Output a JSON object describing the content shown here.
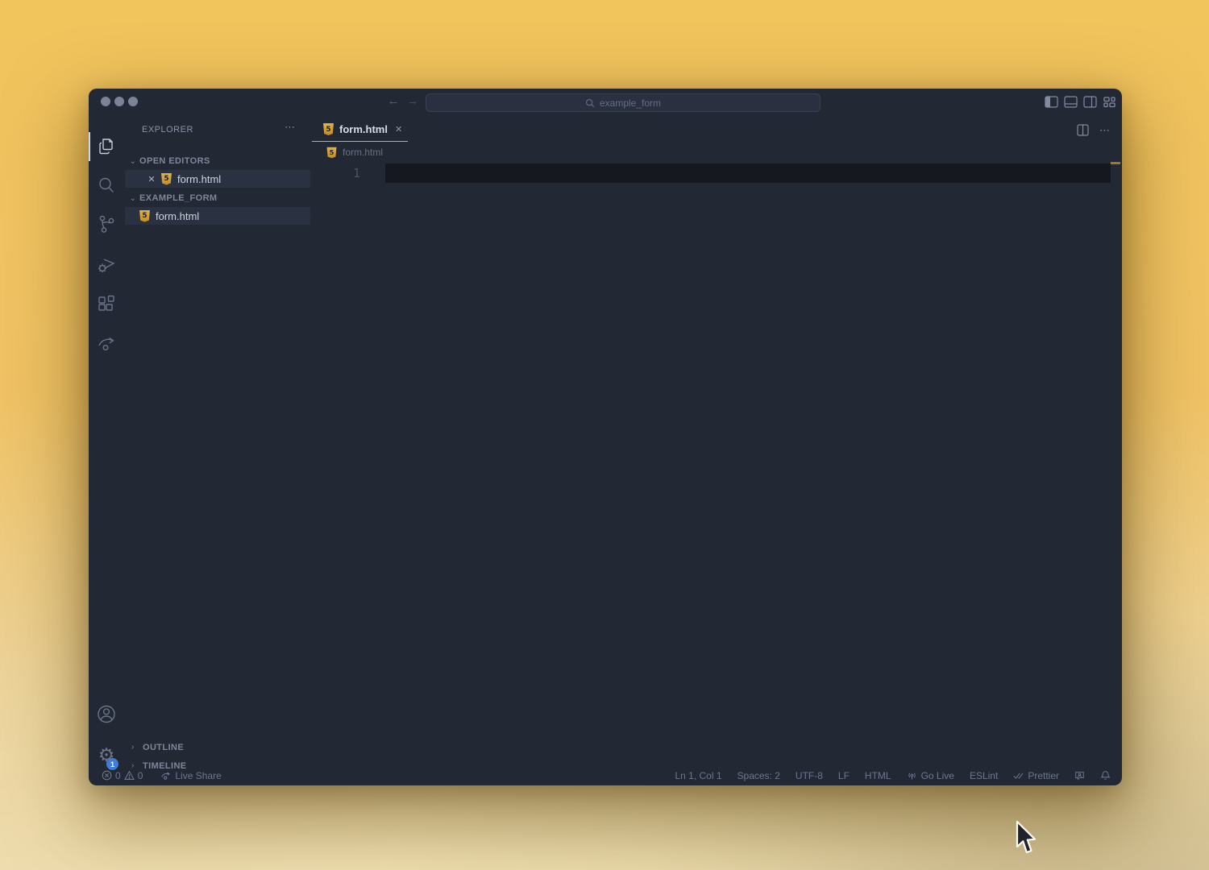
{
  "titlebar": {
    "search_value": "example_form",
    "back_icon": "←",
    "forward_icon": "→"
  },
  "icons": {
    "html_badge": "5",
    "close_icon": "✕",
    "ellipsis_icon": "⋯",
    "chevron_down": "⌄",
    "chevron_right": "›",
    "gear": "⚙"
  },
  "explorer": {
    "title": "EXPLORER",
    "open_editors_label": "OPEN EDITORS",
    "folder_label": "EXAMPLE_FORM",
    "open_editor_file": "form.html",
    "folder_file": "form.html",
    "outline_label": "OUTLINE",
    "timeline_label": "TIMELINE"
  },
  "editor": {
    "tab_label": "form.html",
    "breadcrumb_file": "form.html",
    "line_number": "1"
  },
  "badges": {
    "settings_count": "1"
  },
  "status_bar": {
    "errors": "0",
    "warnings": "0",
    "live_share": "Live Share",
    "cursor_position": "Ln 1, Col 1",
    "indentation": "Spaces: 2",
    "encoding": "UTF-8",
    "eol": "LF",
    "language": "HTML",
    "go_live": "Go Live",
    "eslint": "ESLint",
    "prettier": "Prettier"
  },
  "colors": {
    "window_bg": "#232835",
    "row_highlight": "#2a3140",
    "current_line": "#15181f",
    "tab_underline": "#9fb2d2",
    "html_icon_gold": "#d9a741",
    "badge_blue": "#3e7ed8",
    "desktop_yellow_top": "#f2c45c",
    "desktop_cream_bottom": "#eedcae"
  }
}
